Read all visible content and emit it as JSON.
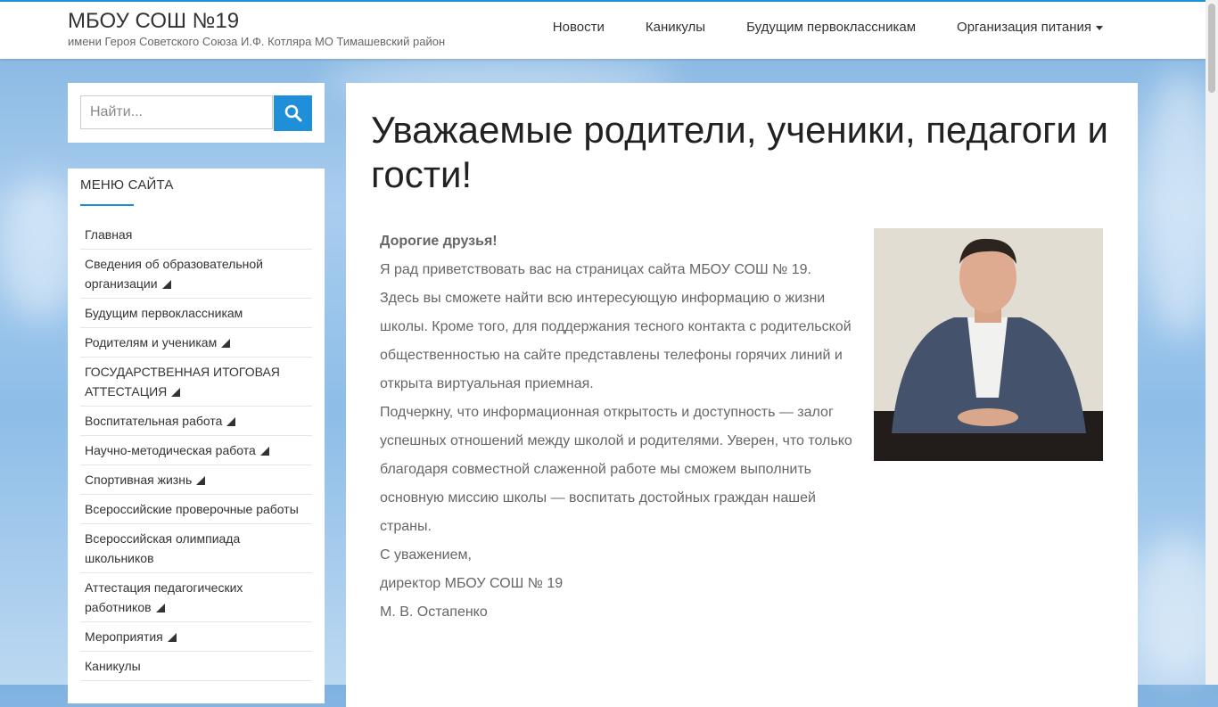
{
  "header": {
    "title": "МБОУ СОШ №19",
    "subtitle": "имени Героя Советского Союза И.Ф. Котляра МО Тимашевский район",
    "nav": [
      "Новости",
      "Каникулы",
      "Будущим первоклассникам",
      "Организация питания"
    ]
  },
  "search": {
    "placeholder": "Найти...",
    "button_icon": "search-icon"
  },
  "menu": {
    "title": "МЕНЮ САЙТА",
    "items": [
      {
        "label": "Главная",
        "sub": false
      },
      {
        "label": "Сведения об образовательной организации",
        "sub": true
      },
      {
        "label": "Будущим первоклассникам",
        "sub": false
      },
      {
        "label": "Родителям и ученикам",
        "sub": true
      },
      {
        "label": "ГОСУДАРСТВЕННАЯ ИТОГОВАЯ АТТЕСТАЦИЯ",
        "sub": true
      },
      {
        "label": "Воспитательная работа",
        "sub": true
      },
      {
        "label": "Научно-методическая работа",
        "sub": true
      },
      {
        "label": "Спортивная жизнь",
        "sub": true
      },
      {
        "label": "Всероссийские проверочные работы",
        "sub": false
      },
      {
        "label": "Всероссийская олимпиада школьников",
        "sub": false
      },
      {
        "label": "Аттестация педагогических работников",
        "sub": true
      },
      {
        "label": "Мероприятия",
        "sub": true
      },
      {
        "label": "Каникулы",
        "sub": false
      }
    ]
  },
  "article": {
    "heading": "Уважаемые родители, ученики, педагоги и гости!",
    "greeting": "Дорогие друзья!",
    "p1": "Я рад приветствовать вас на страницах сайта МБОУ СОШ № 19.",
    "p2": "Здесь вы сможете найти всю интересующую информацию о жизни школы. Кроме того, для поддержания тесного контакта с родительской общественностью на сайте представлены телефоны горячих линий и открыта виртуальная приемная.",
    "p3": "Подчеркну, что информационная открытость и доступность — залог успешных отношений между школой и родителями. Уверен, что только благодаря совместной слаженной работе мы сможем выполнить основную миссию школы — воспитать достойных граждан нашей страны.",
    "closing": "С уважением,",
    "position": "директор МБОУ СОШ № 19",
    "signature": "М. В. Остапенко"
  },
  "colors": {
    "accent": "#1e8fd8"
  }
}
